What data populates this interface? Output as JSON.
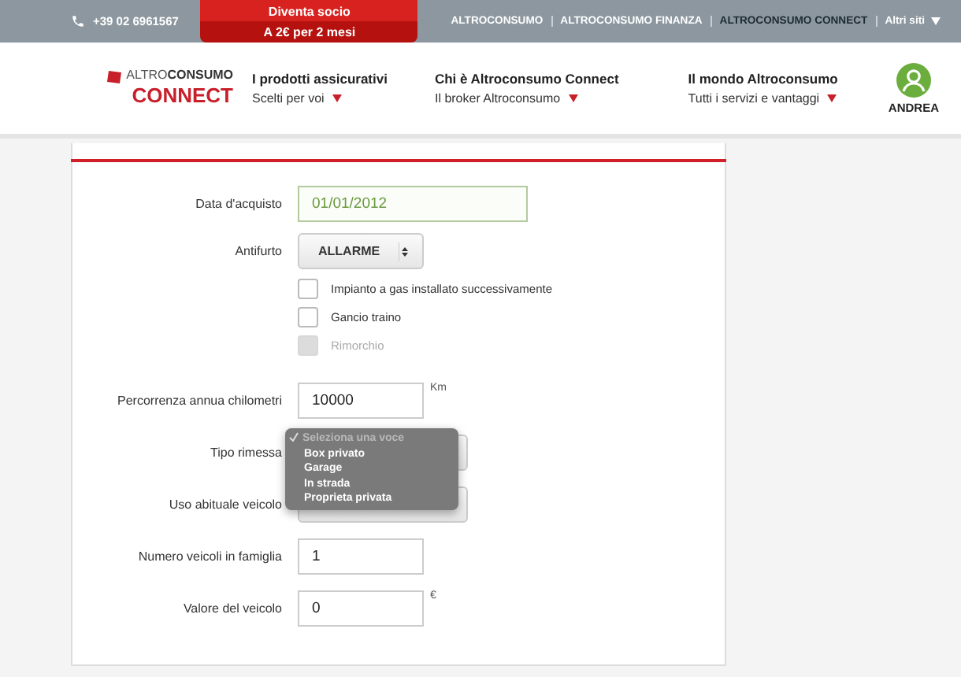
{
  "topbar": {
    "phone": "+39 02 6961567",
    "promo": {
      "title": "Diventa socio",
      "subtitle": "A 2€ per 2 mesi"
    },
    "links": [
      {
        "label": "ALTROCONSUMO",
        "selected": false
      },
      {
        "label": "ALTROCONSUMO FINANZA",
        "selected": false
      },
      {
        "label": "ALTROCONSUMO CONNECT",
        "selected": true
      }
    ],
    "more": "Altri siti"
  },
  "header": {
    "logo": {
      "top_a": "ALTRO",
      "top_b": "CONSUMO",
      "bottom": "CONNECT"
    },
    "nav": [
      {
        "title": "I prodotti assicurativi",
        "subtitle": "Scelti per voi"
      },
      {
        "title": "Chi è Altroconsumo Connect",
        "subtitle": "Il broker Altroconsumo"
      },
      {
        "title": "Il mondo Altroconsumo",
        "subtitle": "Tutti i servizi e vantaggi"
      }
    ],
    "user": "ANDREA"
  },
  "form": [
    {
      "kind": "date",
      "label": "Data d'acquisto",
      "value": "01/01/2012"
    },
    {
      "kind": "select",
      "label": "Antifurto",
      "value": "ALLARME"
    },
    {
      "kind": "checkbox",
      "label": "Impianto a gas installato successivamente",
      "checked": false,
      "disabled": false
    },
    {
      "kind": "checkbox",
      "label": "Gancio traino",
      "checked": false,
      "disabled": false
    },
    {
      "kind": "checkbox",
      "label": "Rimorchio",
      "checked": false,
      "disabled": true
    },
    {
      "kind": "text",
      "label": "Percorrenza annua chilometri",
      "value": "10000",
      "unit": "Km"
    },
    {
      "kind": "select",
      "label": "Tipo rimessa",
      "menu": [
        {
          "label": "Seleziona una voce",
          "selected": true
        },
        {
          "label": "Box privato",
          "selected": false
        },
        {
          "label": "Garage",
          "selected": false
        },
        {
          "label": "In strada",
          "selected": false
        },
        {
          "label": "Proprieta privata",
          "selected": false
        }
      ]
    },
    {
      "kind": "select",
      "label": "Uso abituale veicolo"
    },
    {
      "kind": "text",
      "label": "Numero veicoli in famiglia",
      "value": "1"
    },
    {
      "kind": "text",
      "label": "Valore del veicolo",
      "value": "0",
      "unit": "€"
    }
  ]
}
